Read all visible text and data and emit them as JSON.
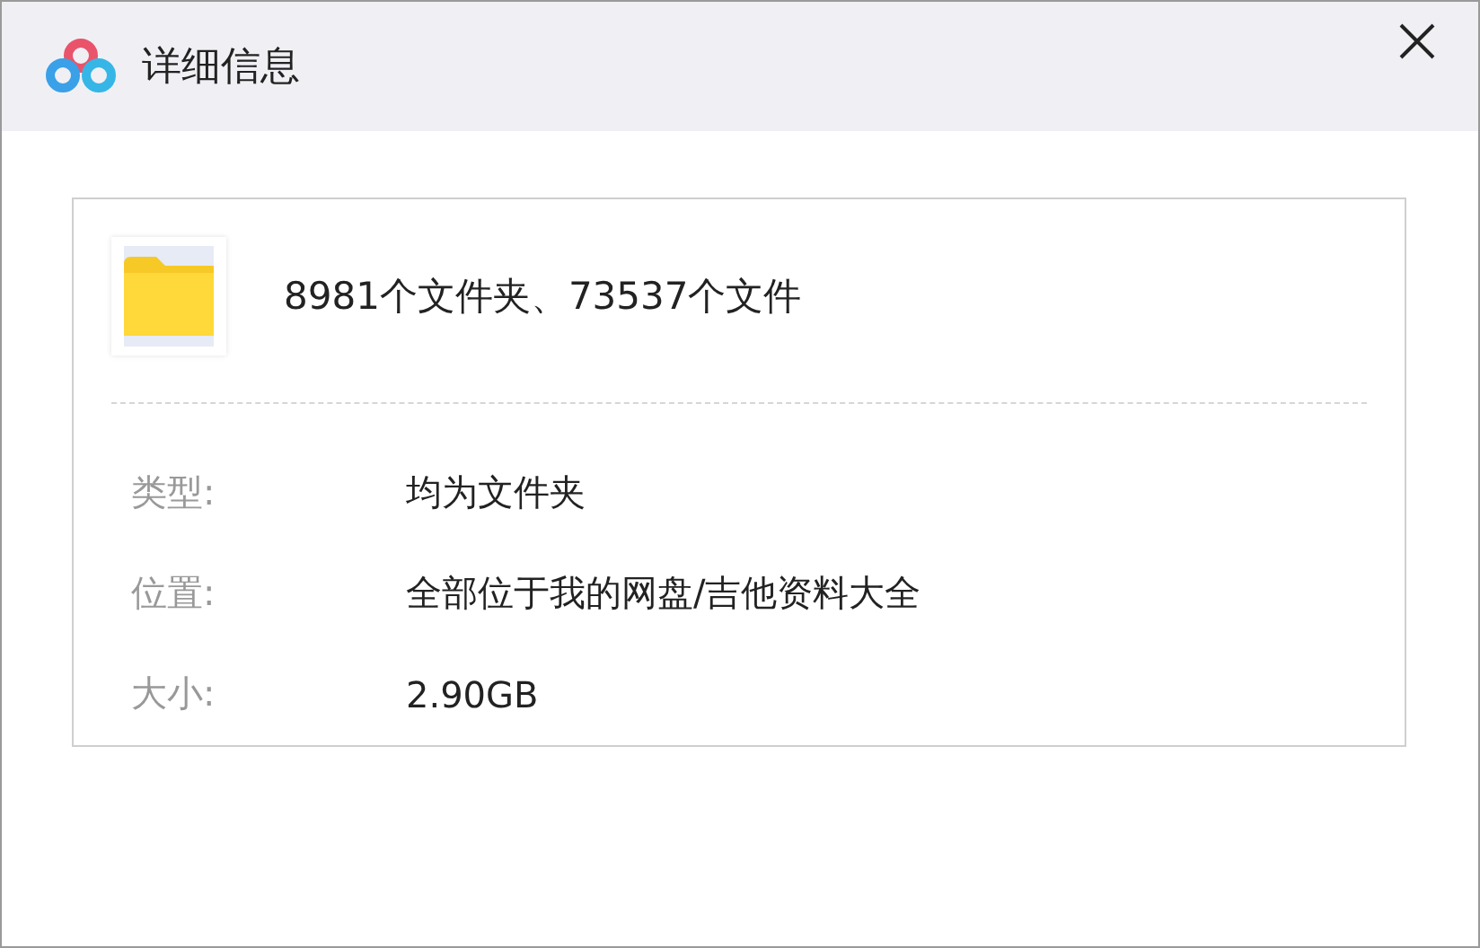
{
  "window": {
    "title": "详细信息"
  },
  "summary": "8981个文件夹、73537个文件",
  "properties": [
    {
      "label": "类型:",
      "value": "均为文件夹"
    },
    {
      "label": "位置:",
      "value": "全部位于我的网盘/吉他资料大全"
    },
    {
      "label": "大小:",
      "value": "2.90GB"
    }
  ]
}
